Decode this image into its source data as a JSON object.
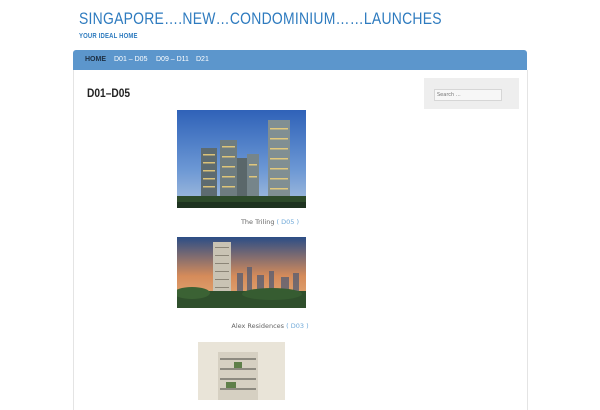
{
  "site": {
    "title": "Singapore….New…Condominium……Launches",
    "tagline": "Your Ideal Home"
  },
  "nav": {
    "items": [
      {
        "label": "Home",
        "active": true
      },
      {
        "label": "D01 – D05",
        "active": false
      },
      {
        "label": "D09 – D11",
        "active": false
      },
      {
        "label": "D21",
        "active": false
      }
    ]
  },
  "page": {
    "title": "D01–D05"
  },
  "sidebar": {
    "search_placeholder": "Search …"
  },
  "listings": [
    {
      "name": "The Triling",
      "district_text": "( D05 )"
    },
    {
      "name": "Alex Residences",
      "district_text": "( D03 )"
    }
  ],
  "colors": {
    "accent": "#2e7bbf",
    "nav_bg": "#5c96cc",
    "link": "#6ea8d8"
  }
}
